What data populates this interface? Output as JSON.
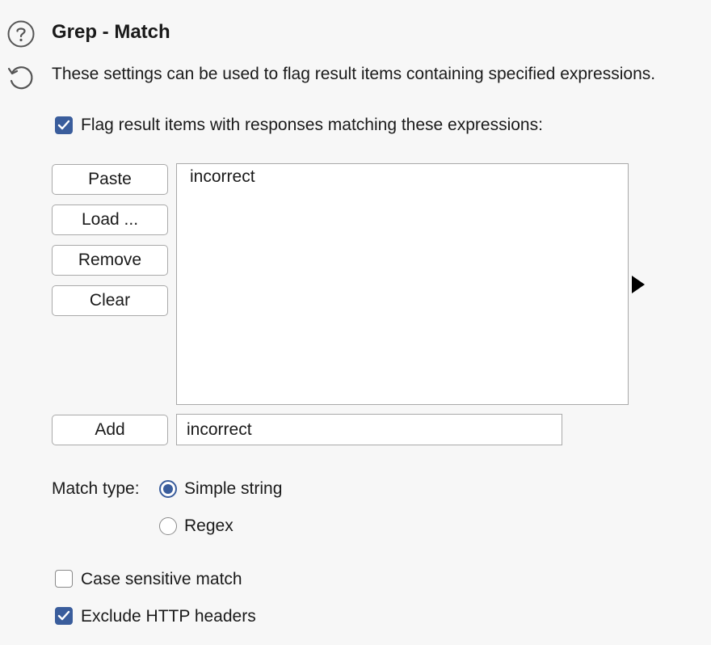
{
  "header": {
    "title": "Grep - Match",
    "description": "These settings can be used to flag result items containing specified expressions.",
    "help_icon": "help-circle-icon",
    "restore_icon": "restore-defaults-icon"
  },
  "flag_option": {
    "label": "Flag result items with responses matching these expressions:",
    "checked": true
  },
  "buttons": {
    "paste": "Paste",
    "load": "Load ...",
    "remove": "Remove",
    "clear": "Clear",
    "add": "Add"
  },
  "expressions": {
    "items": [
      "incorrect"
    ]
  },
  "add_input": {
    "value": "incorrect"
  },
  "match_type": {
    "label": "Match type:",
    "options": [
      {
        "label": "Simple string",
        "selected": true
      },
      {
        "label": "Regex",
        "selected": false
      }
    ]
  },
  "case_sensitive": {
    "label": "Case sensitive match",
    "checked": false
  },
  "exclude_headers": {
    "label": "Exclude HTTP headers",
    "checked": true
  },
  "colors": {
    "accent": "#3a5d9c",
    "background": "#f7f7f7"
  }
}
